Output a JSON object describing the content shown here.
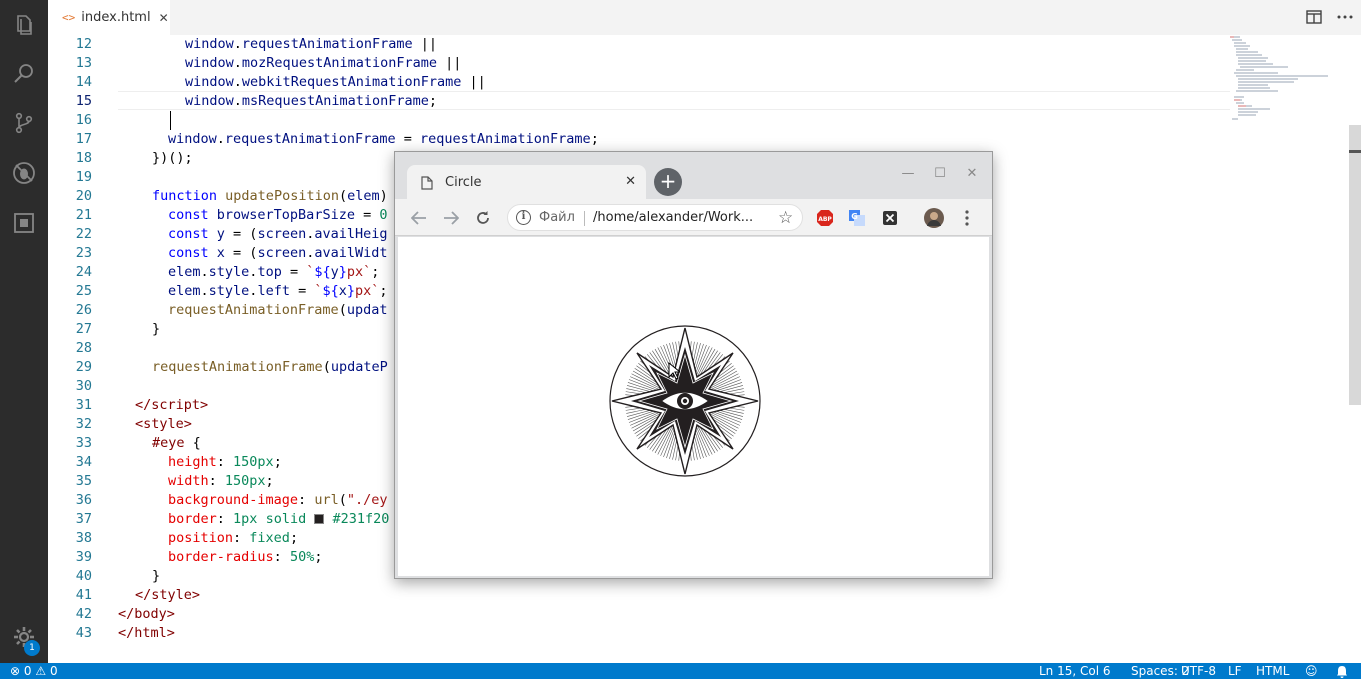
{
  "editor": {
    "tab_label": "index.html",
    "tab_close": "✕",
    "lines": [
      {
        "n": "12"
      },
      {
        "n": "13"
      },
      {
        "n": "14"
      },
      {
        "n": "15"
      },
      {
        "n": "16"
      },
      {
        "n": "17"
      },
      {
        "n": "18"
      },
      {
        "n": "19"
      },
      {
        "n": "20"
      },
      {
        "n": "21"
      },
      {
        "n": "22"
      },
      {
        "n": "23"
      },
      {
        "n": "24"
      },
      {
        "n": "25"
      },
      {
        "n": "26"
      },
      {
        "n": "27"
      },
      {
        "n": "28"
      },
      {
        "n": "29"
      },
      {
        "n": "30"
      },
      {
        "n": "31"
      },
      {
        "n": "32"
      },
      {
        "n": "33"
      },
      {
        "n": "34"
      },
      {
        "n": "35"
      },
      {
        "n": "36"
      },
      {
        "n": "37"
      },
      {
        "n": "38"
      },
      {
        "n": "39"
      },
      {
        "n": "40"
      },
      {
        "n": "41"
      },
      {
        "n": "42"
      },
      {
        "n": "43"
      }
    ]
  },
  "statusbar": {
    "errors": "0",
    "warnings": "0",
    "position": "Ln 15, Col 6",
    "spaces": "Spaces: 2",
    "encoding": "UTF-8",
    "eol": "LF",
    "language": "HTML"
  },
  "activity": {
    "badge": "1"
  },
  "browser": {
    "tab_title": "Circle",
    "file_label": "Файл",
    "url": "/home/alexander/Work...",
    "close": "✕",
    "minimize": "—",
    "maximize": "☐",
    "window_close": "✕",
    "new_tab": "+"
  },
  "colors": {
    "activity_bar": "#2c2c2c",
    "status_bar": "#007acc",
    "browser_frame": "#dedfe1",
    "swatch": "#231f20"
  }
}
